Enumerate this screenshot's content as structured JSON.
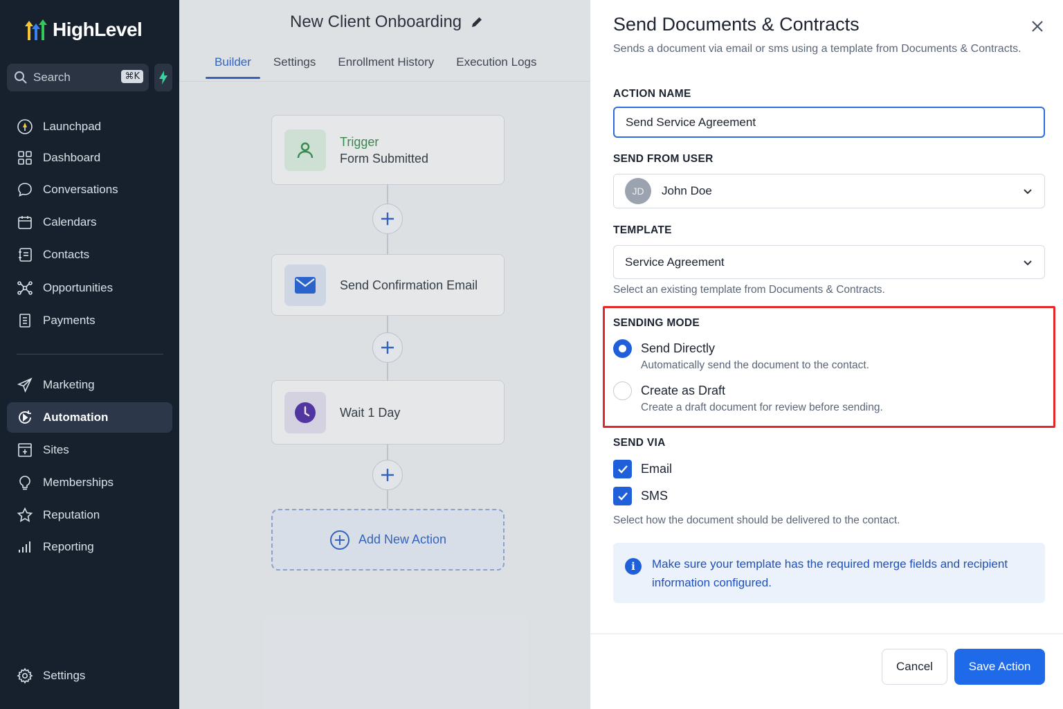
{
  "app": {
    "brand": "HighLevel"
  },
  "sidebar": {
    "search_label": "Search",
    "search_shortcut": "⌘K",
    "items": [
      {
        "label": "Launchpad",
        "icon": "launchpad-icon"
      },
      {
        "label": "Dashboard",
        "icon": "dashboard-icon"
      },
      {
        "label": "Conversations",
        "icon": "chat-icon"
      },
      {
        "label": "Calendars",
        "icon": "calendar-icon"
      },
      {
        "label": "Contacts",
        "icon": "contacts-icon"
      },
      {
        "label": "Opportunities",
        "icon": "opportunities-icon"
      },
      {
        "label": "Payments",
        "icon": "payments-icon"
      },
      {
        "label": "Marketing",
        "icon": "send-icon"
      },
      {
        "label": "Automation",
        "icon": "automation-icon",
        "active": true
      },
      {
        "label": "Sites",
        "icon": "sites-icon"
      },
      {
        "label": "Memberships",
        "icon": "memberships-icon"
      },
      {
        "label": "Reputation",
        "icon": "star-icon"
      },
      {
        "label": "Reporting",
        "icon": "reporting-icon"
      },
      {
        "label": "Settings",
        "icon": "gear-icon"
      }
    ]
  },
  "workflow": {
    "title": "New Client Onboarding",
    "tabs": [
      {
        "label": "Builder",
        "active": true
      },
      {
        "label": "Settings"
      },
      {
        "label": "Enrollment History"
      },
      {
        "label": "Execution Logs"
      }
    ],
    "trigger": {
      "kind": "Trigger",
      "label": "Form Submitted"
    },
    "steps": [
      {
        "label": "Send Confirmation Email",
        "icon": "mail-icon"
      },
      {
        "label": "Wait 1 Day",
        "icon": "clock-icon"
      }
    ],
    "add_action_label": "Add New Action"
  },
  "panel": {
    "title": "Send Documents & Contracts",
    "subtitle": "Sends a document via email or sms using a template from Documents & Contracts.",
    "action_name_label": "ACTION NAME",
    "action_name_value": "Send Service Agreement",
    "send_from_label": "SEND FROM USER",
    "send_from_initials": "JD",
    "send_from_value": "John Doe",
    "template_label": "TEMPLATE",
    "template_value": "Service Agreement",
    "template_help": "Select an existing template from Documents & Contracts.",
    "sending_mode_label": "SENDING MODE",
    "sending_modes": [
      {
        "title": "Send Directly",
        "desc": "Automatically send the document to the contact.",
        "selected": true
      },
      {
        "title": "Create as Draft",
        "desc": "Create a draft document for review before sending.",
        "selected": false
      }
    ],
    "send_via_label": "SEND VIA",
    "send_via": [
      {
        "label": "Email",
        "checked": true
      },
      {
        "label": "SMS",
        "checked": true
      }
    ],
    "send_via_help": "Select how the document should be delivered to the contact.",
    "info_text": "Make sure your template has the required merge fields and recipient information configured.",
    "cancel_label": "Cancel",
    "save_label": "Save Action"
  },
  "colors": {
    "accent": "#1f6ae8",
    "sidebar_bg": "#17202d",
    "highlight": "#e22828"
  }
}
